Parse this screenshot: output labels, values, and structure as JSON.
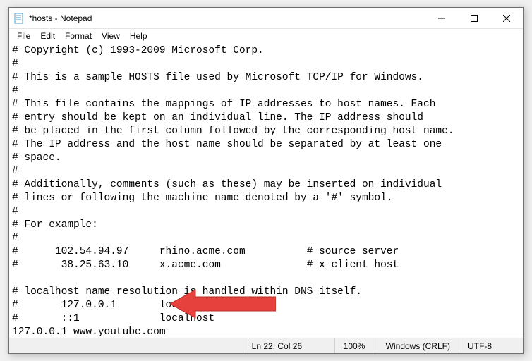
{
  "window": {
    "title": "*hosts - Notepad"
  },
  "menu": {
    "file": "File",
    "edit": "Edit",
    "format": "Format",
    "view": "View",
    "help": "Help"
  },
  "content": "# Copyright (c) 1993-2009 Microsoft Corp.\n#\n# This is a sample HOSTS file used by Microsoft TCP/IP for Windows.\n#\n# This file contains the mappings of IP addresses to host names. Each\n# entry should be kept on an individual line. The IP address should\n# be placed in the first column followed by the corresponding host name.\n# The IP address and the host name should be separated by at least one\n# space.\n#\n# Additionally, comments (such as these) may be inserted on individual\n# lines or following the machine name denoted by a '#' symbol.\n#\n# For example:\n#\n#      102.54.94.97     rhino.acme.com          # source server\n#       38.25.63.10     x.acme.com              # x client host\n\n# localhost name resolution is handled within DNS itself.\n#       127.0.0.1       localhost\n#       ::1             localhost\n127.0.0.1 www.youtube.com",
  "status": {
    "position": "Ln 22, Col 26",
    "zoom": "100%",
    "line_ending": "Windows (CRLF)",
    "encoding": "UTF-8"
  }
}
